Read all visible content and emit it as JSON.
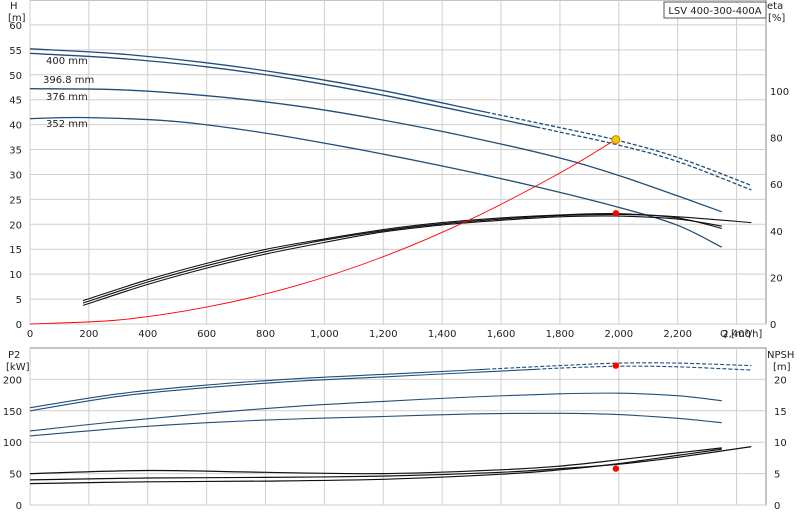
{
  "title_box": "LSV 400-300-400A",
  "chart_data": [
    {
      "type": "line",
      "panel": "top",
      "xlabel": "Q [m³/h]",
      "ylabel_left": [
        "H",
        "[m]"
      ],
      "ylabel_right": [
        "eta",
        "[%]"
      ],
      "xlim": [
        0,
        2500
      ],
      "ylim_left": [
        0,
        65
      ],
      "ylim_right": [
        0,
        139
      ],
      "x_ticks": [
        0,
        200,
        400,
        600,
        800,
        1000,
        1200,
        1400,
        1600,
        1800,
        2000,
        2200,
        2400
      ],
      "x_tick_labels": [
        "0",
        "200",
        "400",
        "600",
        "800",
        "1,000",
        "1,200",
        "1,400",
        "1,600",
        "1,800",
        "2,000",
        "2,200",
        "2,400"
      ],
      "y_ticks_left": [
        0,
        5,
        10,
        15,
        20,
        25,
        30,
        35,
        40,
        45,
        50,
        55,
        60
      ],
      "y_ticks_right": [
        0,
        20,
        40,
        60,
        80,
        100
      ],
      "grid": true,
      "head_curves": [
        {
          "name": "400 mm",
          "color": "#1f4e79",
          "x": [
            0,
            300,
            600,
            900,
            1200,
            1500,
            1800,
            2000,
            2200,
            2450
          ],
          "y": [
            55.2,
            54.2,
            52.4,
            49.9,
            46.8,
            43.1,
            39.4,
            36.8,
            33.4,
            27.8
          ],
          "dashed_from": 1550
        },
        {
          "name": "396.8 mm",
          "color": "#1f4e79",
          "x": [
            0,
            300,
            600,
            900,
            1200,
            1500,
            1800,
            2000,
            2200,
            2450
          ],
          "y": [
            54.3,
            53.3,
            51.6,
            49.1,
            45.9,
            42.3,
            38.5,
            35.9,
            32.6,
            26.9
          ],
          "dashed_from": 1720
        },
        {
          "name": "376 mm",
          "color": "#1f4e79",
          "x": [
            0,
            300,
            600,
            900,
            1200,
            1500,
            1800,
            2000,
            2200,
            2350
          ],
          "y": [
            47.2,
            47.0,
            45.8,
            43.8,
            40.9,
            37.4,
            33.3,
            29.8,
            25.7,
            22.5
          ]
        },
        {
          "name": "352 mm",
          "color": "#1f4e79",
          "x": [
            0,
            200,
            500,
            800,
            1100,
            1400,
            1700,
            2000,
            2200,
            2350
          ],
          "y": [
            41.2,
            41.4,
            40.6,
            38.3,
            35.2,
            31.7,
            27.8,
            23.4,
            19.8,
            15.4
          ]
        }
      ],
      "efficiency_curves": [
        {
          "x": [
            180,
            400,
            600,
            800,
            1000,
            1200,
            1400,
            1600,
            1800,
            2000,
            2200,
            2450
          ],
          "y": [
            9,
            18,
            25,
            31,
            36,
            40,
            43,
            45,
            46.5,
            47,
            46,
            43.5
          ]
        },
        {
          "x": [
            180,
            400,
            600,
            800,
            1000,
            1200,
            1400,
            1600,
            1800,
            2000,
            2200,
            2350
          ],
          "y": [
            8,
            17,
            24,
            30,
            35,
            39.5,
            42.5,
            44.5,
            46,
            46.3,
            45,
            42
          ]
        },
        {
          "x": [
            180,
            400,
            600,
            800,
            1000,
            1200,
            1400,
            1600,
            1800,
            2000,
            2200,
            2350
          ],
          "y": [
            10,
            19,
            26,
            32,
            36.5,
            40.5,
            43.5,
            45.5,
            46.8,
            47.3,
            45.5,
            41
          ]
        }
      ],
      "system_curve": {
        "color": "#ff0000",
        "x": [
          0,
          300,
          600,
          900,
          1200,
          1500,
          1800,
          2000
        ],
        "y": [
          0,
          0.8,
          3.4,
          7.6,
          13.5,
          21.1,
          30.3,
          37.4
        ]
      },
      "duty_point": {
        "x": 1990,
        "y": 37.0,
        "color": "#f5c800"
      },
      "eta_point": {
        "x": 1990,
        "y": 47.5,
        "color": "#ff0000"
      },
      "curve_labels": [
        "400 mm",
        "396.8 mm",
        "376 mm",
        "352 mm"
      ]
    },
    {
      "type": "line",
      "panel": "bottom",
      "ylabel_left": [
        "P2",
        "[kW]"
      ],
      "ylabel_right": [
        "NPSH",
        "[m]"
      ],
      "xlim": [
        0,
        2500
      ],
      "ylim_left": [
        0,
        250
      ],
      "ylim_right": [
        0,
        25
      ],
      "y_ticks_left": [
        0,
        50,
        100,
        150,
        200
      ],
      "y_ticks_right": [
        0,
        5,
        10,
        15,
        20
      ],
      "grid": true,
      "power_curves": [
        {
          "x": [
            0,
            300,
            600,
            900,
            1200,
            1500,
            1800,
            2000,
            2200,
            2450
          ],
          "y": [
            155,
            177,
            191,
            201,
            208,
            215,
            222,
            226,
            226,
            222
          ],
          "dashed_from": 1550
        },
        {
          "x": [
            0,
            300,
            600,
            900,
            1200,
            1500,
            1800,
            2000,
            2200,
            2450
          ],
          "y": [
            150,
            173,
            187,
            197,
            204,
            211,
            218,
            221,
            220,
            215
          ],
          "dashed_from": 1720
        },
        {
          "x": [
            0,
            300,
            600,
            900,
            1200,
            1500,
            1800,
            2000,
            2200,
            2350
          ],
          "y": [
            118,
            133,
            146,
            157,
            165,
            172,
            177,
            178,
            174,
            166
          ]
        },
        {
          "x": [
            0,
            300,
            600,
            900,
            1200,
            1500,
            1800,
            2000,
            2200,
            2350
          ],
          "y": [
            110,
            122,
            131,
            137,
            141,
            145,
            146,
            144,
            138,
            131
          ]
        }
      ],
      "npsh_curves": [
        {
          "x": [
            0,
            400,
            800,
            1200,
            1600,
            1800,
            2000,
            2200,
            2450
          ],
          "y": [
            4.0,
            4.3,
            4.4,
            4.6,
            5.2,
            5.8,
            6.5,
            7.6,
            9.3
          ]
        },
        {
          "x": [
            0,
            400,
            800,
            1200,
            1600,
            1800,
            2000,
            2200,
            2350
          ],
          "y": [
            5.0,
            5.5,
            5.2,
            5.0,
            5.6,
            6.2,
            7.2,
            8.3,
            9.1
          ]
        },
        {
          "x": [
            0,
            400,
            800,
            1200,
            1600,
            1800,
            2000,
            2200,
            2350
          ],
          "y": [
            3.4,
            3.7,
            3.8,
            4.1,
            4.9,
            5.6,
            6.6,
            7.9,
            8.9
          ]
        }
      ],
      "power_point": {
        "x": 1990,
        "y": 222,
        "color": "#ff0000"
      },
      "npsh_point": {
        "x": 1990,
        "y": 5.8,
        "color": "#ff0000"
      }
    }
  ]
}
